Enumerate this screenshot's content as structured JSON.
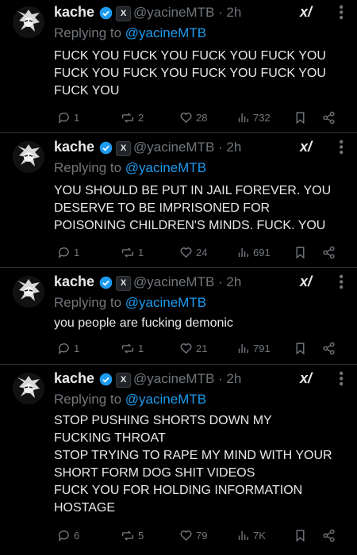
{
  "tweets": [
    {
      "name": "kache",
      "handle": "@yacineMTB",
      "time": "2h",
      "replying_prefix": "Replying to ",
      "replying_to": "@yacineMTB",
      "lines": [
        "FUCK YOU FUCK YOU FUCK YOU FUCK YOU",
        "FUCK YOU FUCK YOU FUCK YOU FUCK YOU",
        "FUCK YOU"
      ],
      "replies": "1",
      "reposts": "2",
      "likes": "28",
      "views": "732"
    },
    {
      "name": "kache",
      "handle": "@yacineMTB",
      "time": "2h",
      "replying_prefix": "Replying to ",
      "replying_to": "@yacineMTB",
      "lines": [
        "YOU SHOULD BE PUT IN JAIL FOREVER. YOU",
        "DESERVE TO BE IMPRISONED FOR",
        "POISONING CHILDREN'S MINDS. FUCK. YOU"
      ],
      "replies": "1",
      "reposts": "1",
      "likes": "24",
      "views": "691"
    },
    {
      "name": "kache",
      "handle": "@yacineMTB",
      "time": "2h",
      "replying_prefix": "Replying to ",
      "replying_to": "@yacineMTB",
      "lines": [
        "you people are fucking demonic"
      ],
      "replies": "1",
      "reposts": "1",
      "likes": "21",
      "views": "791"
    },
    {
      "name": "kache",
      "handle": "@yacineMTB",
      "time": "2h",
      "replying_prefix": "Replying to ",
      "replying_to": "@yacineMTB",
      "lines": [
        "STOP PUSHING SHORTS DOWN MY",
        "FUCKING THROAT",
        "STOP TRYING TO RAPE MY MIND WITH YOUR",
        "SHORT FORM DOG SHIT VIDEOS",
        "FUCK YOU FOR HOLDING INFORMATION",
        "HOSTAGE"
      ],
      "replies": "6",
      "reposts": "5",
      "likes": "79",
      "views": "7K"
    }
  ],
  "icons": {
    "verified": "verified-badge-icon",
    "affiliate": "x-affiliate-badge-icon",
    "grok": "grok-icon",
    "more": "more-options-icon",
    "reply": "reply-icon",
    "repost": "repost-icon",
    "like": "heart-icon",
    "views": "views-icon",
    "bookmark": "bookmark-icon",
    "share": "share-icon"
  },
  "colors": {
    "background": "#000000",
    "text": "#e7e9ea",
    "secondary": "#71767b",
    "accent": "#1d9bf0"
  },
  "badge_letter": "X",
  "grok_glyph": "x/",
  "separator": " · "
}
